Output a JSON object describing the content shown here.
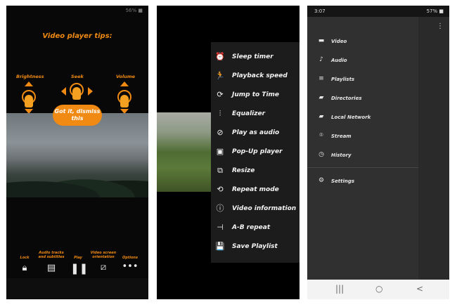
{
  "phone1": {
    "status_right": "56% ■",
    "tips_title": "Video player tips:",
    "gestures": {
      "brightness": "Brightness",
      "seek": "Seek",
      "volume": "Volume"
    },
    "got_it": "Got it, dismiss this",
    "bottom_labels": {
      "lock": "Lock",
      "audio_tracks": "Audio tracks and subtitles",
      "play": "Play",
      "orientation": "Video screen orientation",
      "options": "Options"
    }
  },
  "phone2": {
    "menu_items": [
      {
        "label": "Sleep timer",
        "icon": "alarm-clock-icon",
        "glyph": "⏰"
      },
      {
        "label": "Playback speed",
        "icon": "running-person-icon",
        "glyph": "🏃"
      },
      {
        "label": "Jump to Time",
        "icon": "jump-time-icon",
        "glyph": "⟳"
      },
      {
        "label": "Equalizer",
        "icon": "equalizer-icon",
        "glyph": "⫶"
      },
      {
        "label": "Play as audio",
        "icon": "play-as-audio-icon",
        "glyph": "⊘"
      },
      {
        "label": "Pop-Up player",
        "icon": "popup-player-icon",
        "glyph": "▣"
      },
      {
        "label": "Resize",
        "icon": "crop-icon",
        "glyph": "⧉"
      },
      {
        "label": "Repeat mode",
        "icon": "repeat-icon",
        "glyph": "⟲"
      },
      {
        "label": "Video information",
        "icon": "info-icon",
        "glyph": "ⓘ"
      },
      {
        "label": "A-B repeat",
        "icon": "ab-repeat-icon",
        "glyph": "⊣"
      },
      {
        "label": "Save Playlist",
        "icon": "save-icon",
        "glyph": "💾"
      }
    ]
  },
  "phone3": {
    "status_time": "3:07",
    "status_right": "57% ■",
    "drawer_items": [
      {
        "label": "Video",
        "icon": "video-icon",
        "glyph": "▬"
      },
      {
        "label": "Audio",
        "icon": "music-note-icon",
        "glyph": "♪"
      },
      {
        "label": "Playlists",
        "icon": "playlist-icon",
        "glyph": "≡"
      },
      {
        "label": "Directories",
        "icon": "folder-icon",
        "glyph": "▰"
      },
      {
        "label": "Local Network",
        "icon": "network-folder-icon",
        "glyph": "▰"
      },
      {
        "label": "Stream",
        "icon": "stream-icon",
        "glyph": "⌾"
      },
      {
        "label": "History",
        "icon": "history-icon",
        "glyph": "◷"
      }
    ],
    "settings_label": "Settings",
    "nav": {
      "recent": "|||",
      "home": "○",
      "back": "<"
    }
  }
}
